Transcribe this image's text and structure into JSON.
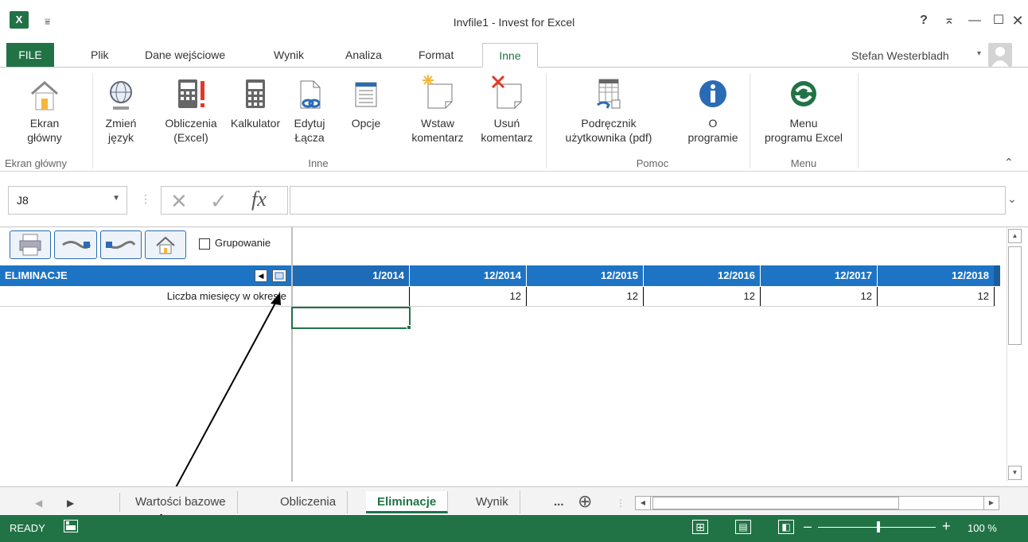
{
  "window": {
    "title": "Invfile1 - Invest for Excel",
    "help": "?",
    "restore": "⌅",
    "minimize": "—",
    "maximize": "☐",
    "close": "✕"
  },
  "quick_access": {
    "customize": "⩸"
  },
  "tabs": [
    {
      "label": "FILE"
    },
    {
      "label": "Plik"
    },
    {
      "label": "Dane wejściowe"
    },
    {
      "label": "Wynik"
    },
    {
      "label": "Analiza"
    },
    {
      "label": "Format"
    },
    {
      "label": "Inne"
    }
  ],
  "user": {
    "name": "Stefan Westerbladh"
  },
  "ribbon": {
    "ekran_glowny": {
      "label1": "Ekran",
      "label2": "główny"
    },
    "zmien_jezyk": {
      "label1": "Zmień",
      "label2": "język"
    },
    "obliczenia": {
      "label1": "Obliczenia",
      "label2": "(Excel)"
    },
    "kalkulator": {
      "label1": "Kalkulator"
    },
    "edytuj": {
      "label1": "Edytuj",
      "label2": "Łącza"
    },
    "opcje": {
      "label1": "Opcje"
    },
    "wstaw": {
      "label1": "Wstaw",
      "label2": "komentarz"
    },
    "usun": {
      "label1": "Usuń",
      "label2": "komentarz"
    },
    "podrecznik": {
      "label1": "Podręcznik",
      "label2": "użytkownika (pdf)"
    },
    "o_programie": {
      "label1": "O",
      "label2": "programie"
    },
    "menu_excel": {
      "label1": "Menu",
      "label2": "programu Excel"
    },
    "groups": {
      "ekran_glowny": "Ekran główny",
      "inne": "Inne",
      "pomoc": "Pomoc",
      "menu": "Menu"
    }
  },
  "formula_bar": {
    "name_box": "J8",
    "fx": "fx",
    "cancel": "✕",
    "enter": "✓",
    "value": ""
  },
  "sheet": {
    "grouping_label": "Grupowanie",
    "section_title": "ELIMINACJE",
    "row_label": "Liczba miesięcy w okresie",
    "columns": [
      {
        "header": "1/2014",
        "value": ""
      },
      {
        "header": "12/2014",
        "value": "12"
      },
      {
        "header": "12/2015",
        "value": "12"
      },
      {
        "header": "12/2016",
        "value": "12"
      },
      {
        "header": "12/2017",
        "value": "12"
      },
      {
        "header": "12/2018",
        "value": "12"
      }
    ]
  },
  "sheet_tabs": {
    "tabs": [
      {
        "label": "Wartości bazowe"
      },
      {
        "label": "Obliczenia"
      },
      {
        "label": "Eliminacje"
      },
      {
        "label": "Wynik"
      },
      {
        "label": "..."
      }
    ],
    "add": "⊕"
  },
  "status_bar": {
    "status": "READY",
    "zoom": "100 %",
    "zoom_level_percent": 100
  }
}
